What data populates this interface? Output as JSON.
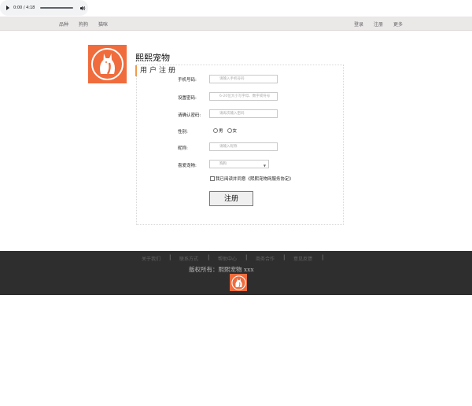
{
  "audio": {
    "time": "0:00 / 4:18",
    "progress": 0
  },
  "nav": {
    "left": [
      "品种",
      "狗狗",
      "猫咪"
    ],
    "right": [
      "登录",
      "注册",
      "更多"
    ]
  },
  "brand": "熙熙宠物",
  "register_title": "用户注册",
  "form": {
    "phone_label": "手机号码:",
    "phone_placeholder": "请输入手机号码",
    "password_label": "设置密码:",
    "password_placeholder": "6-20位大小写字母、数字或符号",
    "confirm_label": "请确认密码:",
    "confirm_placeholder": "请再次输入密码",
    "gender_label": "性别:",
    "gender_options": [
      "男",
      "女"
    ],
    "nickname_label": "昵称:",
    "nickname_placeholder": "请输入昵称",
    "favorite_label": "喜爱宠物:",
    "favorite_value": "狗狗",
    "agree_text": "我已阅读并同意《熙熙宠物网服务协定》",
    "submit_label": "注册"
  },
  "footer": {
    "links": [
      "关于我们",
      "联系方式",
      "帮助中心",
      "商务合作",
      "意见反馈"
    ],
    "separator": "|",
    "copyright": "版权所有：熙熙宠物 xxx"
  },
  "colors": {
    "brand_orange": "#f06c3d",
    "nav_bg": "#ebe8e8",
    "footer_bg": "#2e2e2e"
  },
  "icons": [
    "play-icon",
    "volume-icon",
    "pet-logo-icon"
  ]
}
